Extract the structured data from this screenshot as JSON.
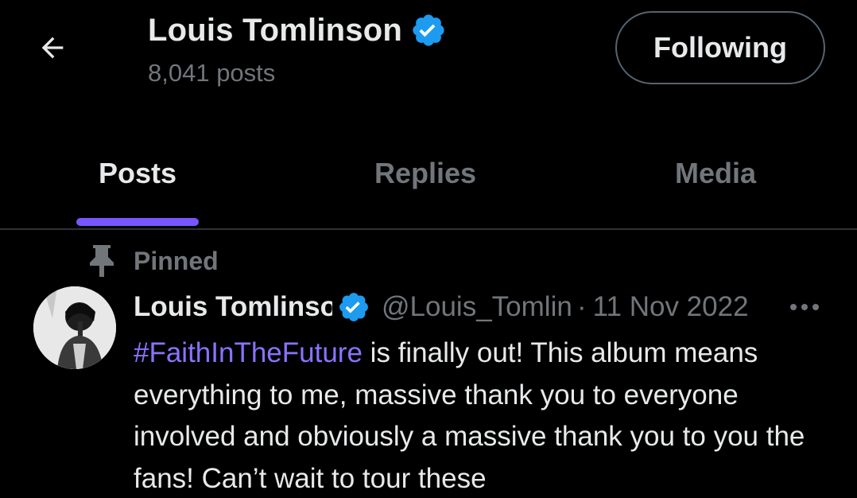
{
  "header": {
    "name": "Louis Tomlinson",
    "post_count": "8,041 posts",
    "follow_label": "Following"
  },
  "tabs": [
    {
      "label": "Posts",
      "active": true
    },
    {
      "label": "Replies",
      "active": false
    },
    {
      "label": "Media",
      "active": false
    }
  ],
  "tweet": {
    "pinned_label": "Pinned",
    "author": "Louis Tomlinson",
    "handle": "@Louis_Tomlinson",
    "separator": "·",
    "date": "11 Nov 2022",
    "hashtag": "#FaithInTheFuture",
    "text_after_hashtag": " is finally out! This album means everything to me, massive thank you to everyone involved and obviously a massive thank you to you the fans! Can’t wait to tour these"
  },
  "icons": {
    "back": "back-arrow-icon",
    "verified": "verified-badge-icon",
    "pin": "pin-icon",
    "more": "more-dots-icon"
  },
  "colors": {
    "background": "#000000",
    "text_primary": "#e7e9ea",
    "text_secondary": "#71767b",
    "verified_blue": "#1d9bf0",
    "accent": "#7856ff",
    "hashtag": "#8b72ff",
    "divider": "#2f3336"
  }
}
